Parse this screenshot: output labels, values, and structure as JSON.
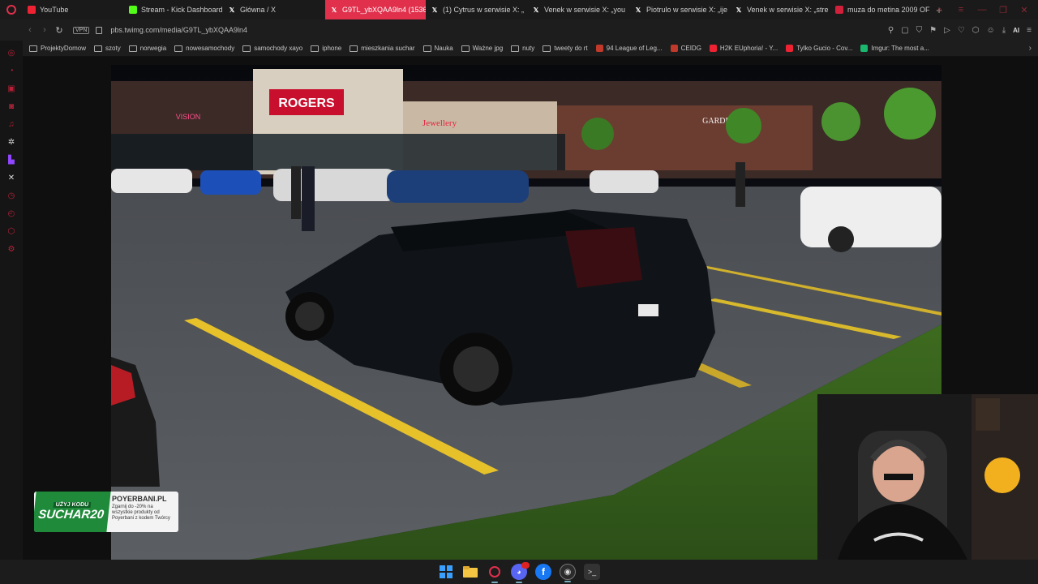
{
  "tabs": [
    {
      "title": "YouTube",
      "icon": "youtube-icon",
      "active": false
    },
    {
      "title": "Stream - Kick Dashboard",
      "icon": "kick-icon",
      "active": false
    },
    {
      "title": "Główna / X",
      "icon": "x-icon",
      "active": false
    },
    {
      "title": "G9TL_ybXQAA9ln4 (1536×",
      "icon": "x-icon",
      "active": true
    },
    {
      "title": "(1) Cytrus w serwisie X: „",
      "icon": "x-icon",
      "active": false
    },
    {
      "title": "Venek w serwisie X: „you",
      "icon": "x-icon",
      "active": false
    },
    {
      "title": "Piotrulo w serwisie X: „ije",
      "icon": "x-icon",
      "active": false
    },
    {
      "title": "Venek w serwisie X: „stre",
      "icon": "x-icon",
      "active": false
    },
    {
      "title": "muza do metina 2009 OF",
      "icon": "music-icon",
      "active": false
    }
  ],
  "address": {
    "vpn_label": "VPN",
    "url": "pbs.twimg.com/media/G9TL_ybXQAA9ln4"
  },
  "toolbar": {
    "ai_label": "AI"
  },
  "bookmarks": [
    {
      "label": "ProjektyDomow",
      "type": "folder"
    },
    {
      "label": "szoty",
      "type": "folder"
    },
    {
      "label": "norwegia",
      "type": "folder"
    },
    {
      "label": "nowesamochody",
      "type": "folder"
    },
    {
      "label": "samochody xayo",
      "type": "folder"
    },
    {
      "label": "iphone",
      "type": "folder"
    },
    {
      "label": "mieszkania suchar",
      "type": "folder"
    },
    {
      "label": "Nauka",
      "type": "folder"
    },
    {
      "label": "Ważne jpg",
      "type": "folder"
    },
    {
      "label": "nuty",
      "type": "folder"
    },
    {
      "label": "tweety do rt",
      "type": "folder"
    },
    {
      "label": "94 League of Leg...",
      "type": "site",
      "color": "#c0392b"
    },
    {
      "label": "CEIDG",
      "type": "site",
      "color": "#c0392b"
    },
    {
      "label": "H2K EUphoria! - Y...",
      "type": "site",
      "color": "#e23"
    },
    {
      "label": "Tylko Gucio - Cov...",
      "type": "site",
      "color": "#e23"
    },
    {
      "label": "Imgur: The most a...",
      "type": "site",
      "color": "#1bb76e"
    }
  ],
  "photo": {
    "store_signs": [
      "ROGERS",
      "Jewellery",
      "VISION",
      "GARDEN"
    ]
  },
  "promo": {
    "code_hint": "UŻYJ KODU",
    "code": "SUCHAR20",
    "brand": "POYERBANI.PL",
    "description": "Zgarnij do -20% na wszystkie produkty od Poyerbani z kodem Twórcy"
  },
  "colors": {
    "accent": "#e0304c",
    "background": "#121212"
  }
}
